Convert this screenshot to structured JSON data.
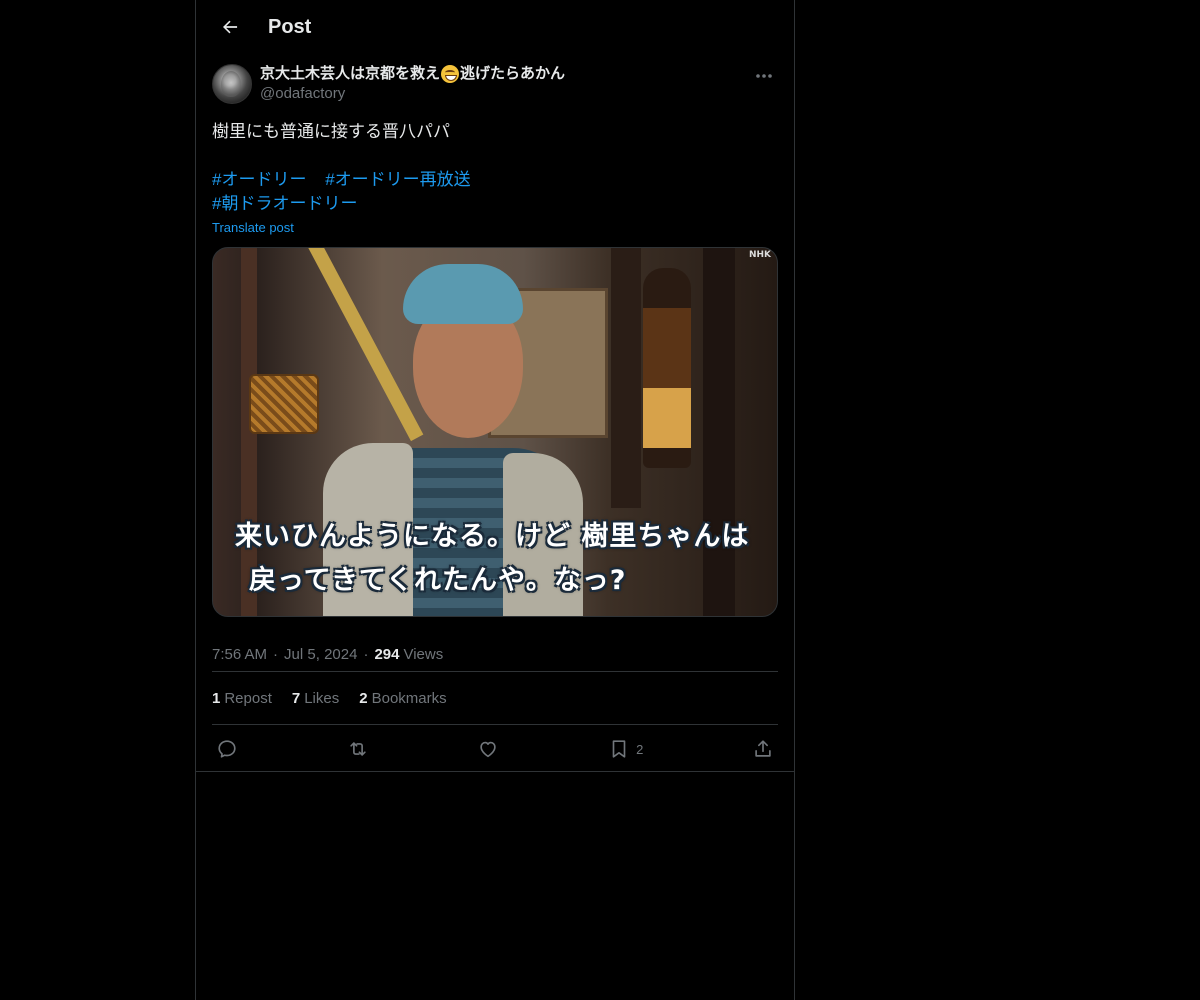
{
  "header": {
    "title": "Post"
  },
  "author": {
    "display_name_pre": "京大土木芸人は京都を救え",
    "display_name_emoji": "grinning-sweat-emoji",
    "display_name_post": "逃げたらあかん",
    "handle": "@odafactory"
  },
  "post": {
    "text": "樹里にも普通に接する晋八パパ",
    "hashtags": [
      "#オードリー",
      "#オードリー再放送",
      "#朝ドラオードリー"
    ],
    "translate_label": "Translate post"
  },
  "media": {
    "watermark": "NHK",
    "subtitle_line1": "来いひんようになる。けど 樹里ちゃんは",
    "subtitle_line2": "戻ってきてくれたんや。なっ?"
  },
  "meta": {
    "time": "7:56 AM",
    "date": "Jul 5, 2024",
    "views_count": "294",
    "views_label": "Views"
  },
  "stats": {
    "reposts_count": "1",
    "reposts_label": "Repost",
    "likes_count": "7",
    "likes_label": "Likes",
    "bookmarks_count": "2",
    "bookmarks_label": "Bookmarks"
  },
  "actions": {
    "reply_icon": "reply-icon",
    "repost_icon": "repost-icon",
    "like_icon": "heart-icon",
    "bookmark_icon": "bookmark-icon",
    "bookmark_count": "2",
    "share_icon": "share-icon"
  },
  "colors": {
    "background": "#000000",
    "text": "#e7e9ea",
    "secondary_text": "#71767b",
    "link": "#1d9bf0",
    "border": "#2f3336"
  }
}
